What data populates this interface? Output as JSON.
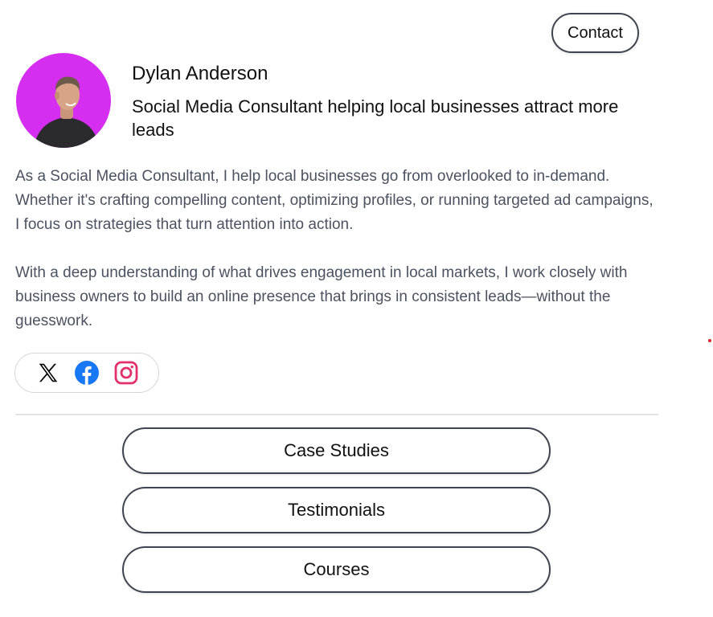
{
  "header": {
    "contact_label": "Contact"
  },
  "profile": {
    "name": "Dylan Anderson",
    "tagline": "Social Media Consultant helping local businesses attract more leads",
    "avatar_bg": "#d62ef0",
    "bio": [
      "As a Social Media Consultant, I help local businesses go from overlooked to in-demand. Whether it's crafting compelling content, optimizing profiles, or running targeted ad campaigns, I focus on strategies that turn attention into action.",
      "With a deep understanding of what drives engagement in local markets, I work closely with business owners to build an online presence that brings in consistent leads—without the guesswork."
    ]
  },
  "social": {
    "icons": [
      "x-icon",
      "facebook-icon",
      "instagram-icon"
    ],
    "colors": {
      "x": "#000000",
      "facebook": "#1877f2",
      "instagram": "#e1306c"
    }
  },
  "links": [
    {
      "label": "Case Studies"
    },
    {
      "label": "Testimonials"
    },
    {
      "label": "Courses"
    }
  ]
}
